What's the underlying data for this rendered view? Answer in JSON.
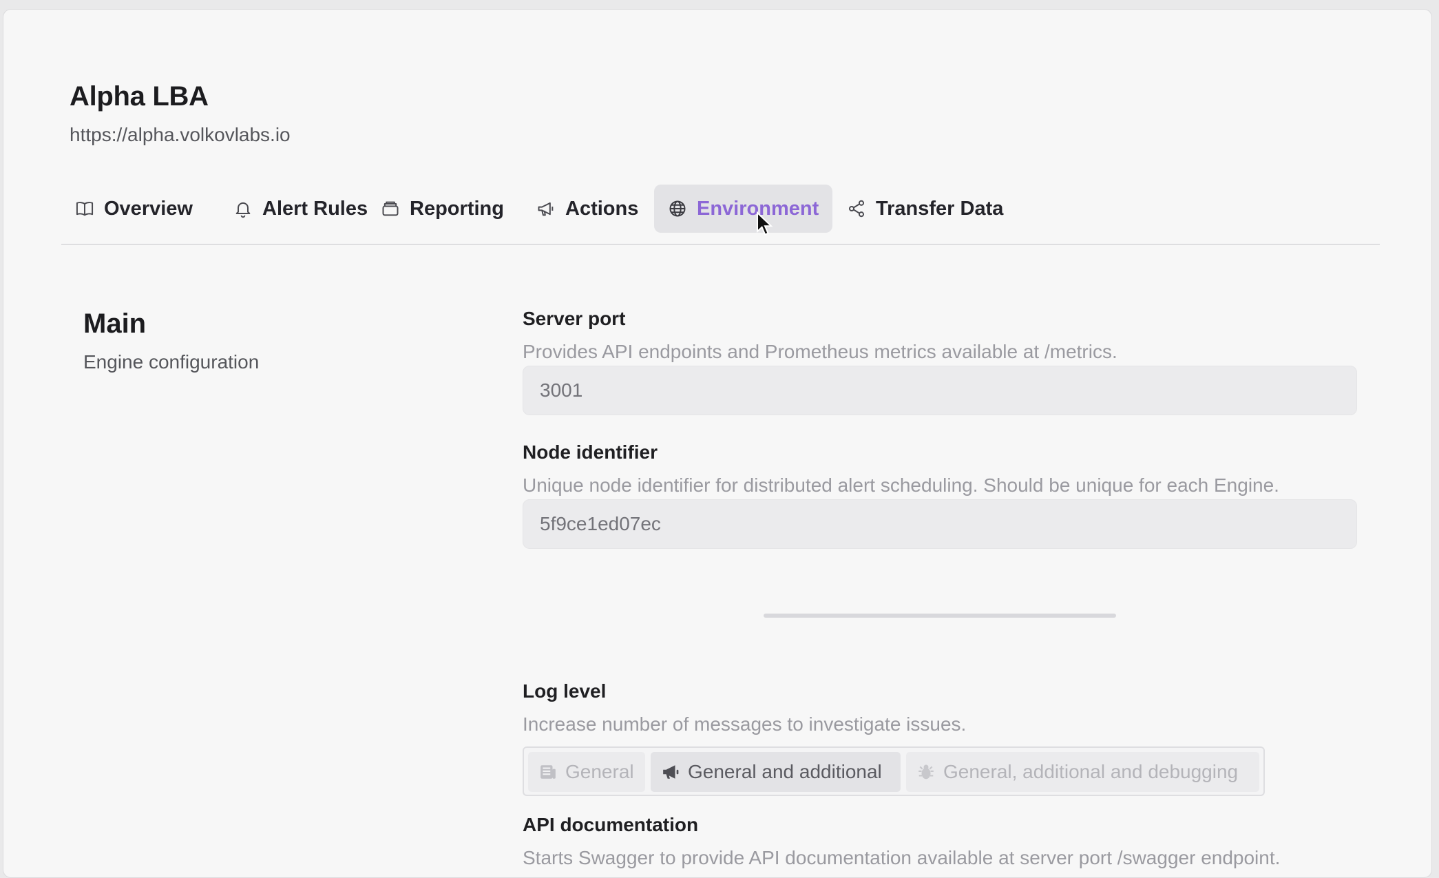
{
  "header": {
    "title": "Alpha LBA",
    "url": "https://alpha.volkovlabs.io"
  },
  "tabs": [
    {
      "label": "Overview",
      "icon": "book-icon"
    },
    {
      "label": "Alert Rules",
      "icon": "bell-icon"
    },
    {
      "label": "Reporting",
      "icon": "archive-icon"
    },
    {
      "label": "Actions",
      "icon": "megaphone-icon"
    },
    {
      "label": "Environment",
      "icon": "globe-icon",
      "active": true
    },
    {
      "label": "Transfer Data",
      "icon": "share-icon"
    }
  ],
  "section": {
    "title": "Main",
    "subtitle": "Engine configuration"
  },
  "fields": {
    "server_port": {
      "label": "Server port",
      "description": "Provides API endpoints and Prometheus metrics available at /metrics.",
      "value": "3001"
    },
    "node_identifier": {
      "label": "Node identifier",
      "description": "Unique node identifier for distributed alert scheduling. Should be unique for each Engine.",
      "value": "5f9ce1ed07ec"
    },
    "log_level": {
      "label": "Log level",
      "description": "Increase number of messages to investigate issues.",
      "options": [
        {
          "label": "General",
          "icon": "newspaper-icon"
        },
        {
          "label": "General and additional",
          "icon": "megaphone-icon",
          "selected": true
        },
        {
          "label": "General, additional and debugging",
          "icon": "bug-icon"
        }
      ]
    },
    "api_documentation": {
      "label": "API documentation",
      "description": "Starts Swagger to provide API documentation available at server port /swagger endpoint."
    }
  },
  "colors": {
    "accent": "#8c67d6",
    "background": "#f7f7f7"
  }
}
